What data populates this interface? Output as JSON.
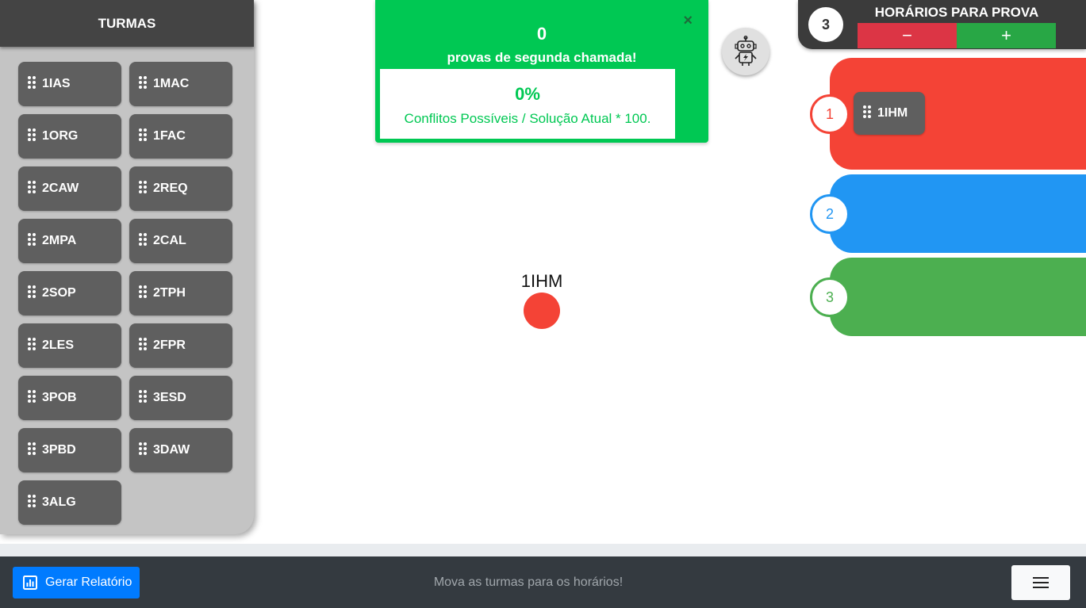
{
  "sidebar": {
    "title": "TURMAS",
    "items": [
      "1IAS",
      "1MAC",
      "1ORG",
      "1FAC",
      "2CAW",
      "2REQ",
      "2MPA",
      "2CAL",
      "2SOP",
      "2TPH",
      "2LES",
      "2FPR",
      "3POB",
      "3ESD",
      "3PBD",
      "3DAW",
      "3ALG"
    ]
  },
  "stats": {
    "close_label": "×",
    "count": "0",
    "label": "provas de segunda chamada!",
    "percent": "0%",
    "formula": "Conflitos Possíveis / Solução Atual * 100."
  },
  "robot": {
    "icon": "robot-icon"
  },
  "graph": {
    "node_label": "1IHM",
    "node_color": "#f44336"
  },
  "slots": {
    "count": "3",
    "title": "HORÁRIOS PARA PROVA",
    "minus_label": "−",
    "plus_label": "+",
    "rows": [
      {
        "number": "1",
        "color": "#f44336",
        "items": [
          "1IHM"
        ]
      },
      {
        "number": "2",
        "color": "#2196f3",
        "items": []
      },
      {
        "number": "3",
        "color": "#4caf50",
        "items": []
      }
    ]
  },
  "footer": {
    "report_label": "Gerar Relatório",
    "report_icon": "bar-chart-icon",
    "message": "Mova as turmas para os horários!",
    "menu_icon": "hamburger-menu-icon"
  },
  "colors": {
    "accent_green": "#00c853",
    "primary_blue": "#007bff",
    "danger": "#dc3545",
    "success": "#28a745",
    "chip": "#5f5f5f"
  }
}
